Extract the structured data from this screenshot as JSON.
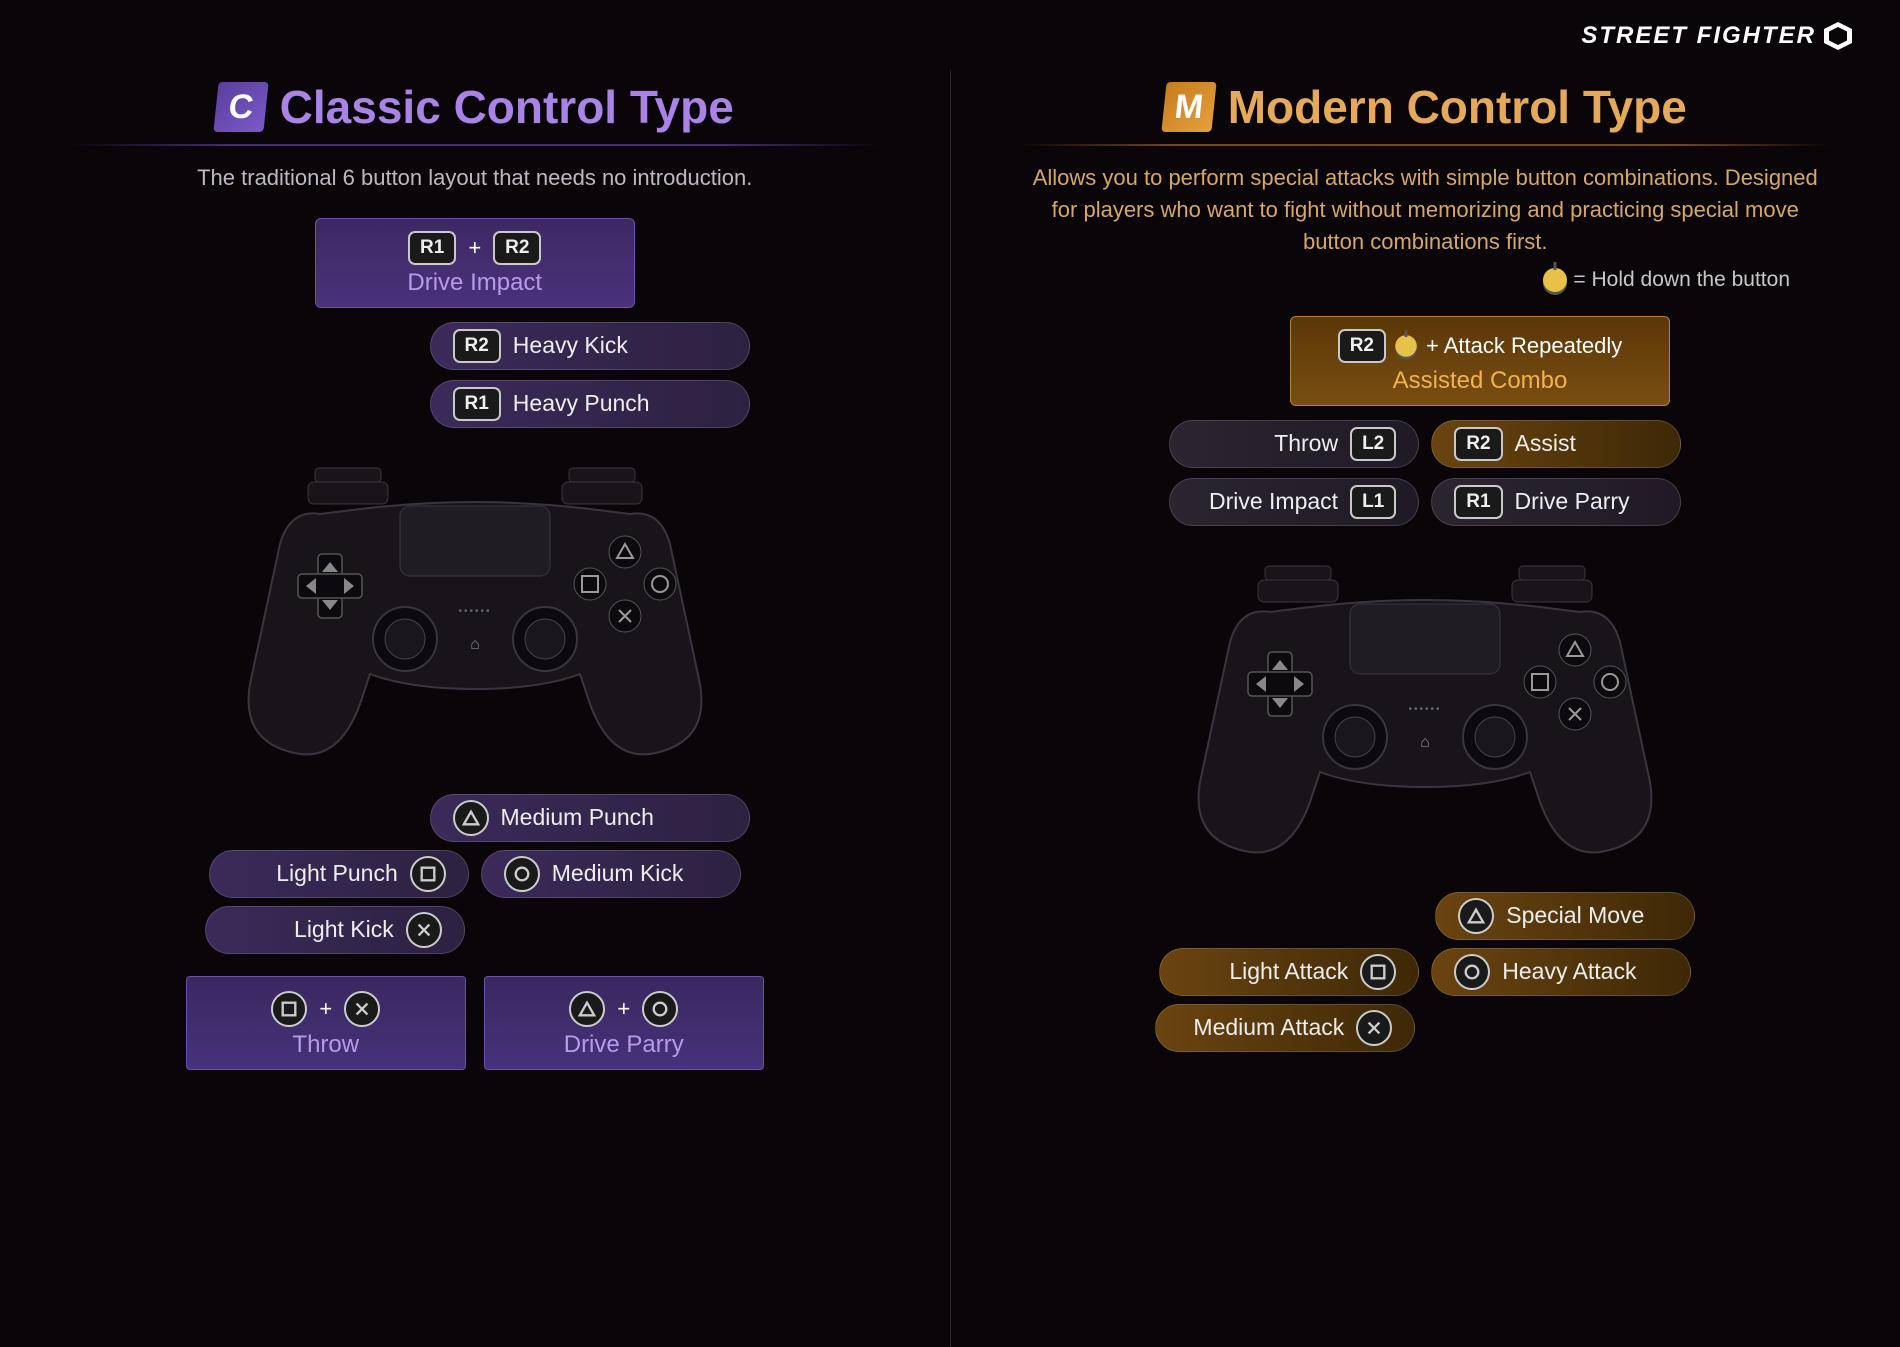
{
  "logo": "STREET FIGHTER",
  "classic": {
    "badge": "C",
    "title": "Classic Control Type",
    "subtitle": "The traditional 6 button layout that needs no introduction.",
    "big_box": {
      "keys": [
        "R1",
        "R2"
      ],
      "label": "Drive Impact"
    },
    "shoulders": [
      {
        "key": "R2",
        "label": "Heavy Kick"
      },
      {
        "key": "R1",
        "label": "Heavy Punch"
      }
    ],
    "face_top": {
      "glyph": "triangle",
      "label": "Medium Punch"
    },
    "face_mid_l": {
      "glyph": "square",
      "label": "Light Punch"
    },
    "face_mid_r": {
      "glyph": "circle",
      "label": "Medium Kick"
    },
    "face_bot": {
      "glyph": "cross",
      "label": "Light Kick"
    },
    "foot_l": {
      "glyphs": [
        "square",
        "cross"
      ],
      "label": "Throw"
    },
    "foot_r": {
      "glyphs": [
        "triangle",
        "circle"
      ],
      "label": "Drive Parry"
    }
  },
  "modern": {
    "badge": "M",
    "title": "Modern Control Type",
    "subtitle": "Allows you to perform special attacks with simple button combinations. Designed for players who want to fight without memorizing and practicing special move button combinations first.",
    "legend": "= Hold down the button",
    "big_box": {
      "key": "R2",
      "extra": "+ Attack Repeatedly",
      "label": "Assisted Combo"
    },
    "shoulders_row1_l": {
      "label": "Throw",
      "key": "L2"
    },
    "shoulders_row1_r": {
      "key": "R2",
      "label": "Assist"
    },
    "shoulders_row2_l": {
      "label": "Drive Impact",
      "key": "L1"
    },
    "shoulders_row2_r": {
      "key": "R1",
      "label": "Drive Parry"
    },
    "face_top": {
      "glyph": "triangle",
      "label": "Special Move"
    },
    "face_mid_l": {
      "glyph": "square",
      "label": "Light Attack"
    },
    "face_mid_r": {
      "glyph": "circle",
      "label": "Heavy Attack"
    },
    "face_bot": {
      "glyph": "cross",
      "label": "Medium Attack"
    }
  }
}
